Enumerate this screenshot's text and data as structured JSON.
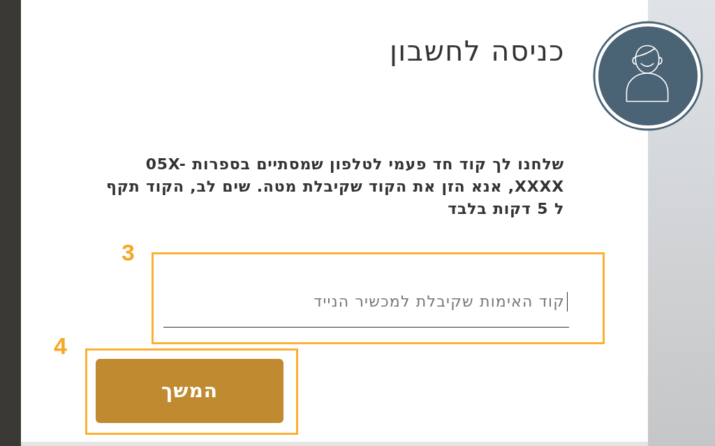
{
  "heading": "כניסה לחשבון",
  "message": "שלחנו לך קוד חד פעמי לטלפון שמסתיים בספרות 05X-XXXX, אנא הזן את הקוד שקיבלת מטה. שים לב, הקוד תקף ל 5 דקות בלבד",
  "code_field": {
    "placeholder": "קוד האימות שקיבלת למכשיר הנייד",
    "focused": true,
    "annotation": "3"
  },
  "continue_button": {
    "label": "המשך",
    "annotation": "4"
  }
}
